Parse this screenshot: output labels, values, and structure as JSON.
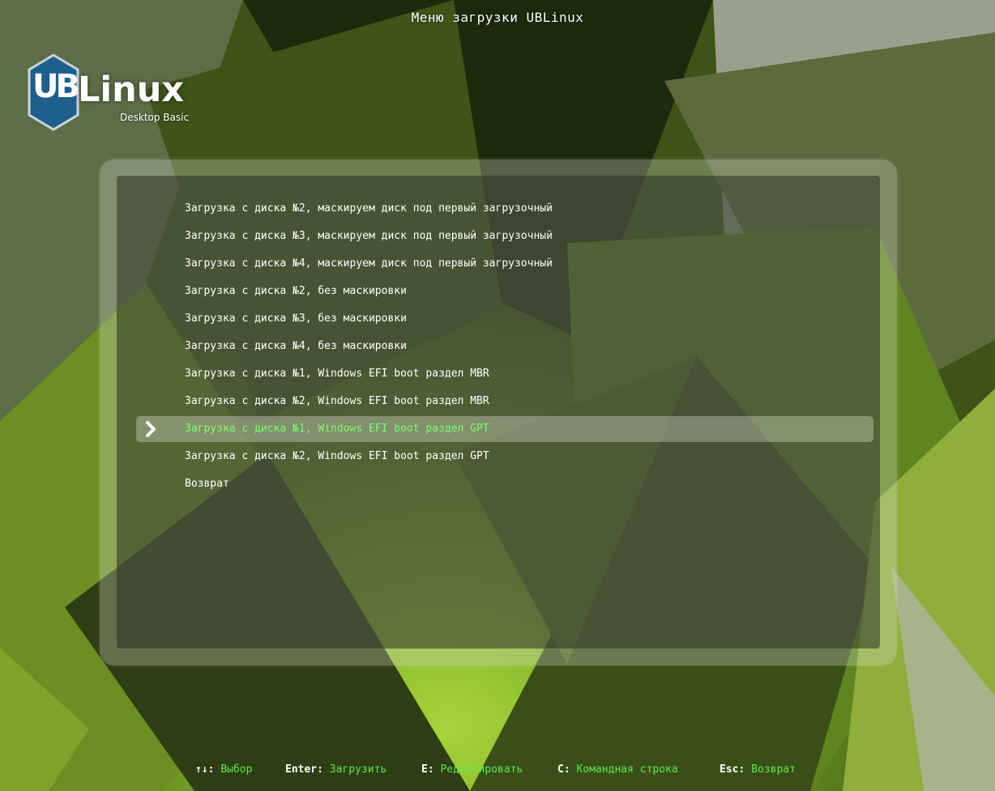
{
  "header": {
    "title": "Меню загрузки UBLinux"
  },
  "logo": {
    "mark": "UB",
    "name": "Linux",
    "edition": "Desktop Basic"
  },
  "menu": {
    "selected_index": 8,
    "items": [
      {
        "label": "Загрузка с диска №2, маскируем диск под первый загрузочный"
      },
      {
        "label": "Загрузка с диска №3, маскируем диск под первый загрузочный"
      },
      {
        "label": "Загрузка с диска №4, маскируем диск под первый загрузочный"
      },
      {
        "label": "Загрузка с диска №2, без маскировки"
      },
      {
        "label": "Загрузка с диска №3, без маскировки"
      },
      {
        "label": "Загрузка с диска №4, без маскировки"
      },
      {
        "label": "Загрузка с диска №1, Windows EFI boot раздел MBR"
      },
      {
        "label": "Загрузка с диска №2, Windows EFI boot раздел MBR"
      },
      {
        "label": "Загрузка с диска №1, Windows EFI boot раздел GPT"
      },
      {
        "label": "Загрузка с диска №2, Windows EFI boot раздел GPT"
      },
      {
        "label": "Возврат"
      }
    ]
  },
  "footer": {
    "hints": [
      {
        "key": "↑↓:",
        "action": "Выбор"
      },
      {
        "key": "Enter:",
        "action": "Загрузить"
      },
      {
        "key": "E:",
        "action": "Редактировать"
      },
      {
        "key": "C:",
        "action": "Командная строка"
      },
      {
        "key": "Esc:",
        "action": "Возврат"
      }
    ]
  },
  "colors": {
    "selected_text": "#7cff6a",
    "hint_action": "#5ee84a",
    "logo_hex": "#1e5f8c"
  },
  "icons": {
    "selection": "chevron-right-icon",
    "logo": "hexagon-logo-icon"
  }
}
